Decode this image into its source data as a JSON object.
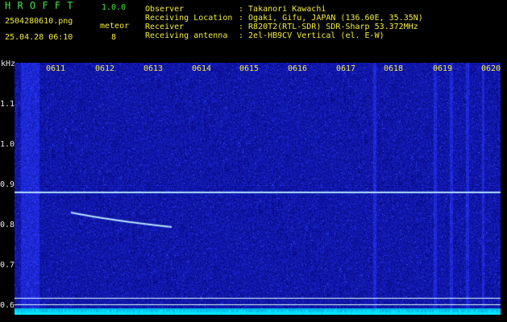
{
  "header": {
    "title": "H R O F F T",
    "version": "1.0.0",
    "filename": "2504280610.png",
    "datetime": "25.04.28 06:10",
    "meteor_label": "meteor",
    "meteor_count": "8",
    "observer_label": "Observer",
    "observer_value": ": Takanori Kawachi",
    "location_label": "Receiving Location",
    "location_value": ": Ogaki, Gifu, JAPAN (136.60E, 35.35N)",
    "receiver_label": "Receiver",
    "receiver_value": ": R820T2(RTL-SDR) SDR-Sharp 53.372MHz",
    "antenna_label": "Receiving antenna",
    "antenna_value": ": 2el-HB9CV Vertical (el. E-W)"
  },
  "axis": {
    "unit": "kHz",
    "time_ticks": [
      "0611",
      "0612",
      "0613",
      "0614",
      "0615",
      "0616",
      "0617",
      "0618",
      "0619",
      "0620"
    ],
    "freq_ticks": [
      "1.1",
      "1.0",
      "0.9",
      "0.8",
      "0.7",
      "0.6"
    ]
  },
  "colors": {
    "background": "#000000",
    "spectrum": "#1a2a9a",
    "signal": "#9fd0ff",
    "baseline": "#00e5ff",
    "label": "#f2ec3c"
  }
}
